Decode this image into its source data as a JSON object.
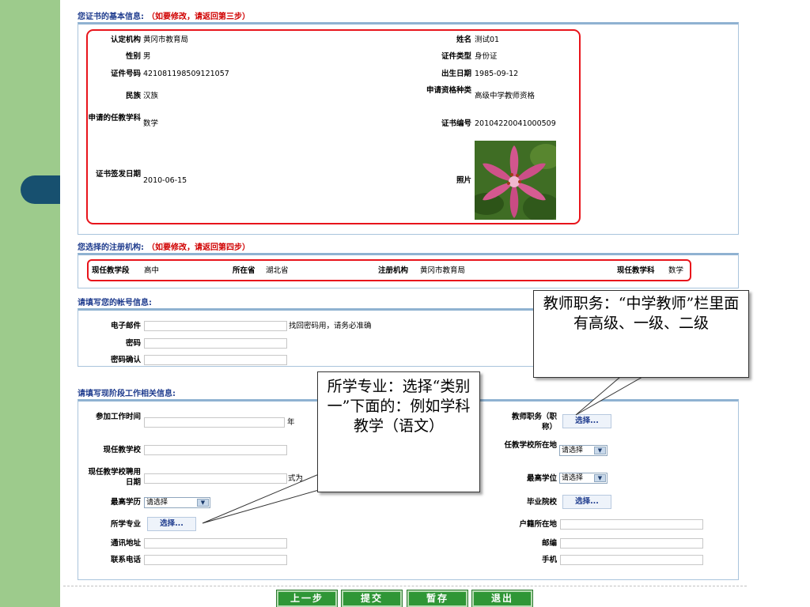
{
  "cert_section": {
    "title": "您证书的基本信息:",
    "note": "（如要修改，请返回第三步）",
    "fields": [
      {
        "label": "认定机构",
        "value": "黄冈市教育局"
      },
      {
        "label": "姓名",
        "value": "测试01"
      },
      {
        "label": "性别",
        "value": "男"
      },
      {
        "label": "证件类型",
        "value": "身份证"
      },
      {
        "label": "证件号码",
        "value": "421081198509121057"
      },
      {
        "label": "出生日期",
        "value": "1985-09-12"
      },
      {
        "label": "民族",
        "value": "汉族"
      },
      {
        "label": "申请资格种类",
        "value": "高级中学教师资格"
      },
      {
        "label": "申请的任教学科",
        "value": "数学"
      },
      {
        "label": "证书编号",
        "value": "20104220041000509"
      },
      {
        "label": "证书签发日期",
        "value": "2010-06-15"
      },
      {
        "label": "照片",
        "value": ""
      }
    ]
  },
  "reg_section": {
    "title": "您选择的注册机构:",
    "note": "（如要修改，请返回第四步）",
    "fields": [
      {
        "label": "现任教学段",
        "value": "高中"
      },
      {
        "label": "所在省",
        "value": "湖北省"
      },
      {
        "label": "注册机构",
        "value": "黄冈市教育局"
      },
      {
        "label": "现任教学科",
        "value": "数学"
      }
    ]
  },
  "account_section": {
    "title": "请填写您的帐号信息:",
    "email_label": "电子邮件",
    "email_hint": "找回密码用，请务必准确",
    "password_label": "密码",
    "confirm_label": "密码确认"
  },
  "work_section": {
    "title": "请填写现阶段工作相关信息:",
    "start_work_label": "参加工作时间",
    "year_unit": "年",
    "school_label": "现任教学校",
    "hire_date_label": "现任教学校聘用日期",
    "hire_date_hint_partial": "式为",
    "highest_edu_label": "最高学历",
    "highest_edu_value": "请选择",
    "major_label": "所学专业",
    "address_label": "通讯地址",
    "phone_label": "联系电话",
    "title_label": "教师职务（职称）",
    "school_location_label": "任教学校所在地",
    "school_location_value": "请选择",
    "degree_label": "最高学位",
    "degree_value": "请选择",
    "graduate_label": "毕业院校",
    "hukou_label": "户籍所在地",
    "postcode_label": "邮编",
    "mobile_label": "手机",
    "pick_label": "选择..."
  },
  "callouts": {
    "title_note": "教师职务：“中学教师”栏里面有高级、一级、二级",
    "major_note": "所学专业：选择“类别一”下面的：例如学科教学（语文）"
  },
  "buttons": {
    "prev": "上一步",
    "submit": "提交",
    "save": "暂存",
    "exit": "退出"
  }
}
